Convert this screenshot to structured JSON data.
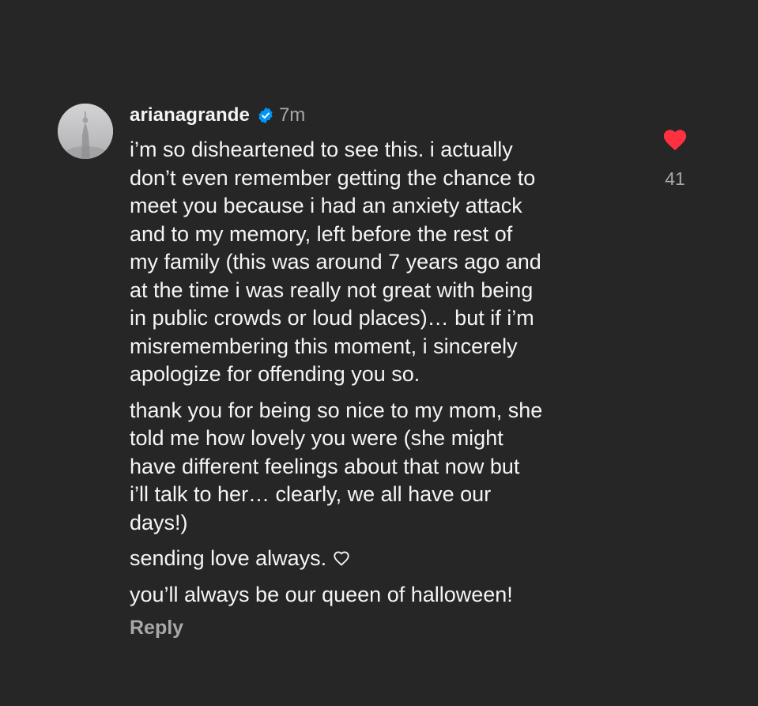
{
  "comment": {
    "username": "arianagrande",
    "verified": true,
    "timestamp": "7m",
    "avatar_icon": "avatar-photo",
    "paragraphs": [
      {
        "lines": [
          "i’m so disheartened to see this. i actually",
          "don’t even remember getting the chance to",
          "meet you because i had an anxiety attack",
          "and to my memory, left before the rest of",
          "my family (this was around 7 years ago and",
          "at the time i was really not great with being",
          "in public crowds or loud places)… but if i’m",
          "misremembering this moment, i sincerely",
          "apologize for offending you so."
        ]
      },
      {
        "lines": [
          "thank you for being so nice to my mom, she",
          "told me how lovely you were (she might",
          "have different feelings about that now but",
          "i’ll talk to her… clearly, we all have our",
          "days!)"
        ]
      },
      {
        "lines": [
          "sending love always."
        ],
        "trailing_icon": "heart-outline-icon"
      },
      {
        "lines": [
          "you’ll always be our queen of halloween!"
        ]
      }
    ],
    "reply_label": "Reply",
    "like": {
      "liked": true,
      "count": "41",
      "icon": "heart-filled-icon"
    }
  },
  "colors": {
    "background": "#262626",
    "text_primary": "#f5f5f5",
    "text_secondary": "#a8a8a8",
    "verified_blue": "#0095f6",
    "like_red": "#ff3040"
  }
}
